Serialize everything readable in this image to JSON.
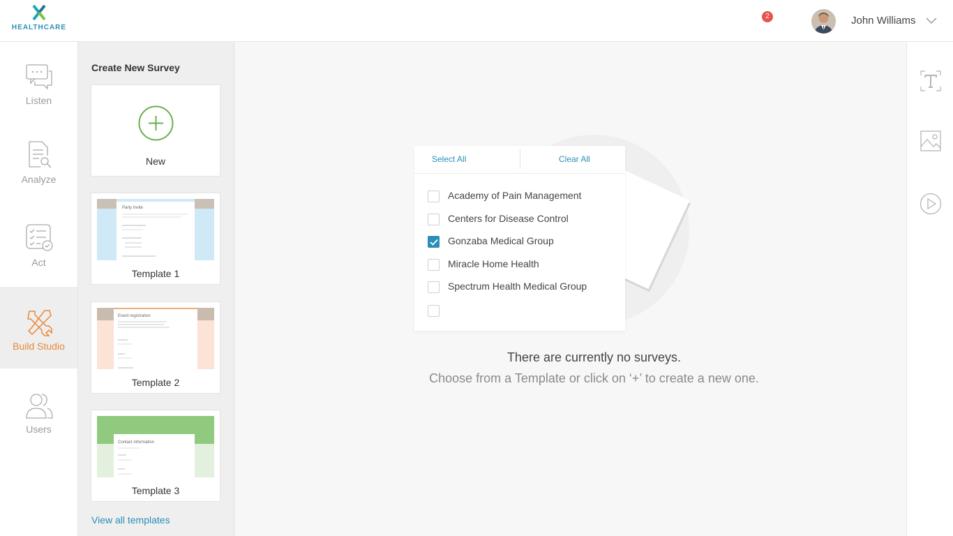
{
  "brand": {
    "name": "HEALTHCARE",
    "color": "#2a8fb8"
  },
  "header": {
    "notification_count": "2",
    "user_name": "John Williams"
  },
  "nav": {
    "items": [
      {
        "label": "Listen",
        "icon": "chat-bubbles-icon"
      },
      {
        "label": "Analyze",
        "icon": "document-search-icon"
      },
      {
        "label": "Act",
        "icon": "checklist-icon"
      },
      {
        "label": "Build Studio",
        "icon": "tools-icon",
        "active": true
      },
      {
        "label": "Users",
        "icon": "users-icon"
      }
    ],
    "active_color": "#e8883a"
  },
  "templates": {
    "heading": "Create New Survey",
    "new_label": "New",
    "items": [
      {
        "label": "Template 1",
        "preview_title": "Party Invite"
      },
      {
        "label": "Template 2",
        "preview_title": "Event registration"
      },
      {
        "label": "Template 3",
        "preview_title": "Contact information"
      }
    ],
    "view_all": "View all templates"
  },
  "filter": {
    "select_all": "Select All",
    "clear_all": "Clear All",
    "options": [
      {
        "label": "Academy of Pain Management",
        "checked": false
      },
      {
        "label": "Centers for Disease Control",
        "checked": false
      },
      {
        "label": "Gonzaba Medical Group",
        "checked": true
      },
      {
        "label": "Miracle Home Health",
        "checked": false
      },
      {
        "label": "Spectrum Health Medical Group",
        "checked": false
      },
      {
        "label": "",
        "checked": false
      }
    ]
  },
  "empty_state": {
    "title": "There are currently no surveys.",
    "subtitle": "Choose from a Template or click on ‘+’ to create a new one."
  },
  "right_toolbar": {
    "tools": [
      "text-tool-icon",
      "image-tool-icon",
      "video-tool-icon"
    ]
  }
}
